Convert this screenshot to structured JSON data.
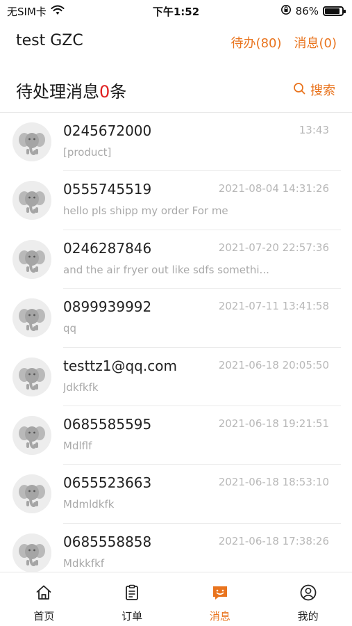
{
  "status_bar": {
    "carrier": "无SIM卡",
    "time": "下午1:52",
    "battery_percent": "86%",
    "battery_level": 0.86,
    "icons": [
      "wifi-icon",
      "orientation-lock-icon",
      "battery-icon"
    ]
  },
  "header": {
    "shop_name": "test GZC",
    "todo_label": "待办(80)",
    "messages_label": "消息(0)"
  },
  "section": {
    "title_prefix": "待处理消息",
    "count": "0",
    "title_suffix": "条",
    "search_label": "搜索"
  },
  "messages": [
    {
      "contact": "0245672000",
      "time": "13:43",
      "preview": "[product]"
    },
    {
      "contact": "0555745519",
      "time": "2021-08-04 14:31:26",
      "preview": "hello pls shipp my order For me"
    },
    {
      "contact": "0246287846",
      "time": "2021-07-20 22:57:36",
      "preview": "and the air fryer out like sdfs somethi..."
    },
    {
      "contact": "0899939992",
      "time": "2021-07-11 13:41:58",
      "preview": "qq"
    },
    {
      "contact": "testtz1@qq.com",
      "time": "2021-06-18 20:05:50",
      "preview": "Jdkfkfk"
    },
    {
      "contact": "0685585595",
      "time": "2021-06-18 19:21:51",
      "preview": "Mdlflf"
    },
    {
      "contact": "0655523663",
      "time": "2021-06-18 18:53:10",
      "preview": "Mdmldkfk"
    },
    {
      "contact": "0685558858",
      "time": "2021-06-18 17:38:26",
      "preview": "Mdkkfkf"
    }
  ],
  "tabbar": {
    "home": "首页",
    "orders": "订单",
    "messages": "消息",
    "mine": "我的",
    "active": "messages"
  },
  "colors": {
    "accent": "#e9741e",
    "count_red": "#e02020",
    "muted_text": "#a9a9a9"
  }
}
